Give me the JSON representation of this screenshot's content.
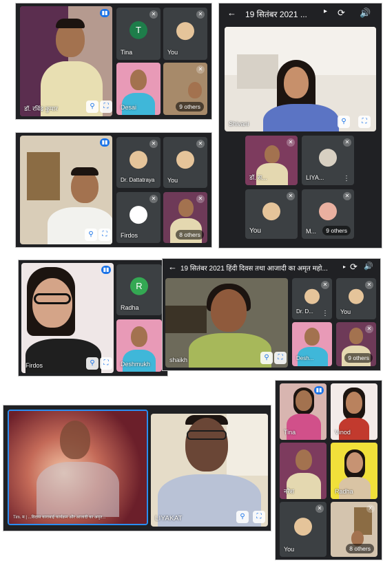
{
  "screenshot1": {
    "main_name": "डॉ. रविंद्र कुमार",
    "tiles": [
      {
        "name": "Tina",
        "letter": "T"
      },
      {
        "name": "You"
      },
      {
        "name": "Desai"
      },
      {
        "others": "9 others"
      }
    ]
  },
  "screenshot2": {
    "title": "19 सितंबर 2021 ...",
    "main_name": "Shivani",
    "tiles": [
      {
        "name": "डॉ. स..."
      },
      {
        "name": "LIYA..."
      },
      {
        "name": "You"
      },
      {
        "name": "M...",
        "others": "9 others"
      }
    ]
  },
  "screenshot3": {
    "main_name": "",
    "tiles": [
      {
        "name": "Dr. Dattatraya"
      },
      {
        "name": "You"
      },
      {
        "name": "Firdos"
      },
      {
        "others": "8 others"
      }
    ]
  },
  "screenshot4": {
    "main_name": "Firdos",
    "tiles": [
      {
        "name": "Radha",
        "letter": "R"
      },
      {
        "name": "Deshmukh"
      }
    ]
  },
  "screenshot5": {
    "title": "19 सितंबर 2021 हिंदी दिवस तथा आजादी का अमृत महो...",
    "main_name": "shaikh",
    "tiles": [
      {
        "name": "Dr. D..."
      },
      {
        "name": "You"
      },
      {
        "name": "Desh..."
      },
      {
        "others": "9 others"
      }
    ]
  },
  "screenshot6": {
    "main_caption": "Tim. म | ...विदास काराबाई कार्यक्रम और आजादी का अमृत...",
    "tile_name": "LIYAKAT"
  },
  "screenshot7": {
    "tiles": [
      {
        "name": "Tina"
      },
      {
        "name": "Vinod"
      },
      {
        "name": "नरेश"
      },
      {
        "name": "Radha"
      },
      {
        "name": "You"
      },
      {
        "others": "8 others"
      }
    ]
  },
  "colors": {
    "meet_bg": "#202124",
    "tile_bg": "#3c4043",
    "accent": "#1a73e8"
  }
}
